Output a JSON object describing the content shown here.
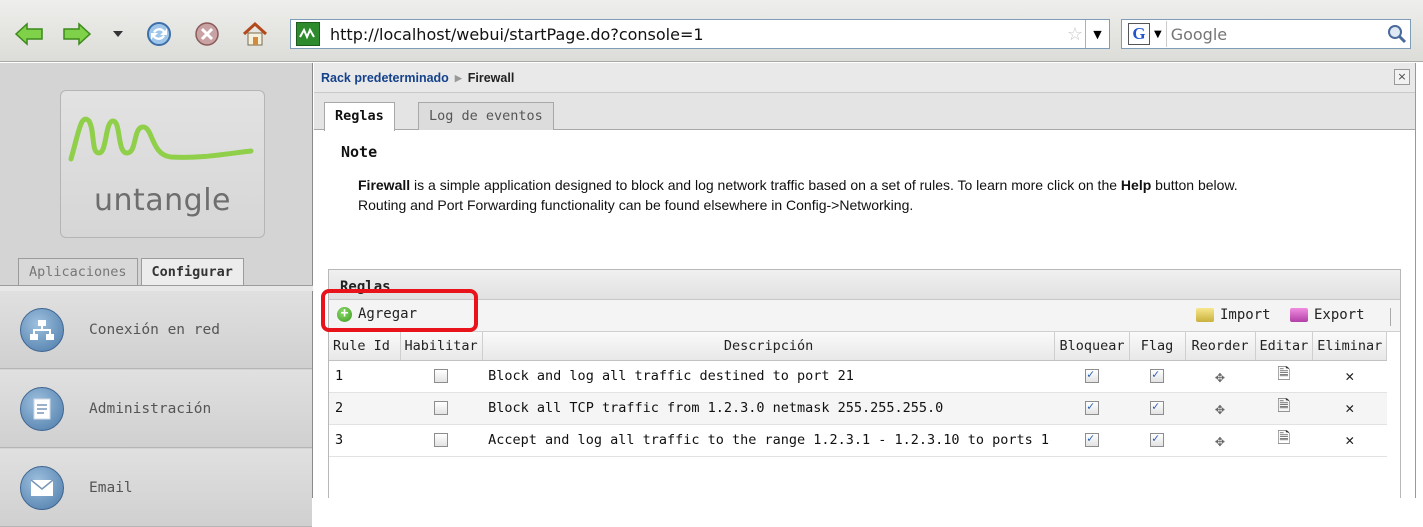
{
  "browser": {
    "url": "http://localhost/webui/startPage.do?console=1",
    "search_placeholder": "Google",
    "icons": [
      "back-arrow-icon",
      "forward-arrow-icon",
      "dropdown-arrow-icon",
      "reload-icon",
      "stop-icon",
      "home-icon",
      "site-favicon",
      "bookmark-star-icon",
      "google-search-icon",
      "search-go-icon"
    ]
  },
  "sidebar": {
    "logo_text": "untangle",
    "logo_trademark": "·",
    "tabs": [
      {
        "label": "Aplicaciones",
        "active": false
      },
      {
        "label": "Configurar",
        "active": true
      }
    ],
    "items": [
      {
        "label": "Conexión en red",
        "icon": "network-icon"
      },
      {
        "label": "Administración",
        "icon": "administration-icon"
      },
      {
        "label": "Email",
        "icon": "email-icon"
      }
    ]
  },
  "main": {
    "breadcrumb": {
      "rack": "Rack predeterminado",
      "separator": "▶",
      "current": "Firewall"
    },
    "close_label": "×",
    "tabs": [
      {
        "label": "Reglas",
        "active": true
      },
      {
        "label": "Log de eventos",
        "active": false
      }
    ],
    "note": {
      "title": "Note",
      "line1_bold_app": "Firewall",
      "line1_rest": " is a simple application designed to block and log network traffic based on a set of rules. To learn more click on the ",
      "line1_help": "Help",
      "line1_end": " button below.",
      "line2": "Routing and Port Forwarding functionality can be found elsewhere in Config->Networking."
    },
    "grid": {
      "title": "Reglas",
      "add_label": "Agregar",
      "import_label": "Import",
      "export_label": "Export",
      "columns": [
        "Rule Id",
        "Habilitar",
        "Descripción",
        "Bloquear",
        "Flag",
        "Reorder",
        "Editar",
        "Eliminar"
      ],
      "rows": [
        {
          "id": "1",
          "enabled": false,
          "description": "Block and log all traffic destined to port 21",
          "block": true,
          "flag": true
        },
        {
          "id": "2",
          "enabled": false,
          "description": "Block all TCP traffic from 1.2.3.0 netmask 255.255.255.0",
          "block": true,
          "flag": true
        },
        {
          "id": "3",
          "enabled": false,
          "description": "Accept and log all traffic to the range 1.2.3.1 - 1.2.3.10 to ports 1",
          "block": true,
          "flag": true
        }
      ],
      "reorder_glyph": "✥",
      "edit_glyph": "🗎",
      "delete_glyph": "✕"
    }
  },
  "colors": {
    "highlight": "#e8131b",
    "breadcrumb_link": "#15428b",
    "checkbox_check": "#2a5fb5"
  }
}
